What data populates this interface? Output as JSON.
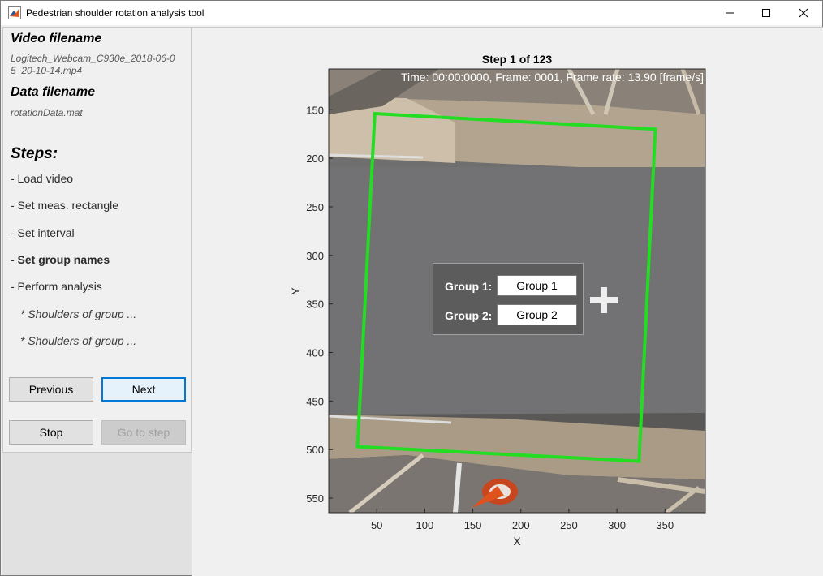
{
  "window": {
    "title": "Pedestrian shoulder rotation analysis tool",
    "controls": {
      "minimize": "minimize-icon",
      "maximize": "maximize-icon",
      "close": "close-icon"
    }
  },
  "sidebar": {
    "video_heading": "Video filename",
    "video_filename_line1": "Logitech_Webcam_C930e_2018-06-0",
    "video_filename_line2": "5_20-10-14.mp4",
    "data_heading": "Data filename",
    "data_filename": "rotationData.mat",
    "steps_heading": "Steps:",
    "steps": [
      {
        "label": "- Load video",
        "active": false
      },
      {
        "label": "- Set meas. rectangle",
        "active": false
      },
      {
        "label": "- Set interval",
        "active": false
      },
      {
        "label": "- Set group names",
        "active": true
      },
      {
        "label": "- Perform analysis",
        "active": false
      },
      {
        "label": "* Shoulders of group ...",
        "active": false
      },
      {
        "label": "* Shoulders of group ...",
        "active": false
      }
    ],
    "buttons": {
      "previous": "Previous",
      "next": "Next",
      "stop": "Stop",
      "goto": "Go to step"
    }
  },
  "plot": {
    "title": "Step 1 of 123",
    "overlay_text": "Time: 00:00:0000, Frame: 0001, Frame rate: 13.90 [frame/s]",
    "xlabel": "X",
    "ylabel": "Y",
    "xlim": [
      0,
      392
    ],
    "ylim": [
      565,
      108
    ],
    "xticks": [
      50,
      100,
      150,
      200,
      250,
      300,
      350
    ],
    "yticks": [
      150,
      200,
      250,
      300,
      350,
      400,
      450,
      500,
      550
    ],
    "rectangle": {
      "color": "#22dd22",
      "points": [
        [
          48,
          154
        ],
        [
          340,
          170
        ],
        [
          323,
          512
        ],
        [
          30,
          497
        ]
      ]
    }
  },
  "group_dialog": {
    "group1_label": "Group 1:",
    "group1_value": "Group 1",
    "group2_label": "Group 2:",
    "group2_value": "Group 2"
  },
  "colors": {
    "accent": "#0078d7",
    "rectangle": "#22dd22"
  }
}
